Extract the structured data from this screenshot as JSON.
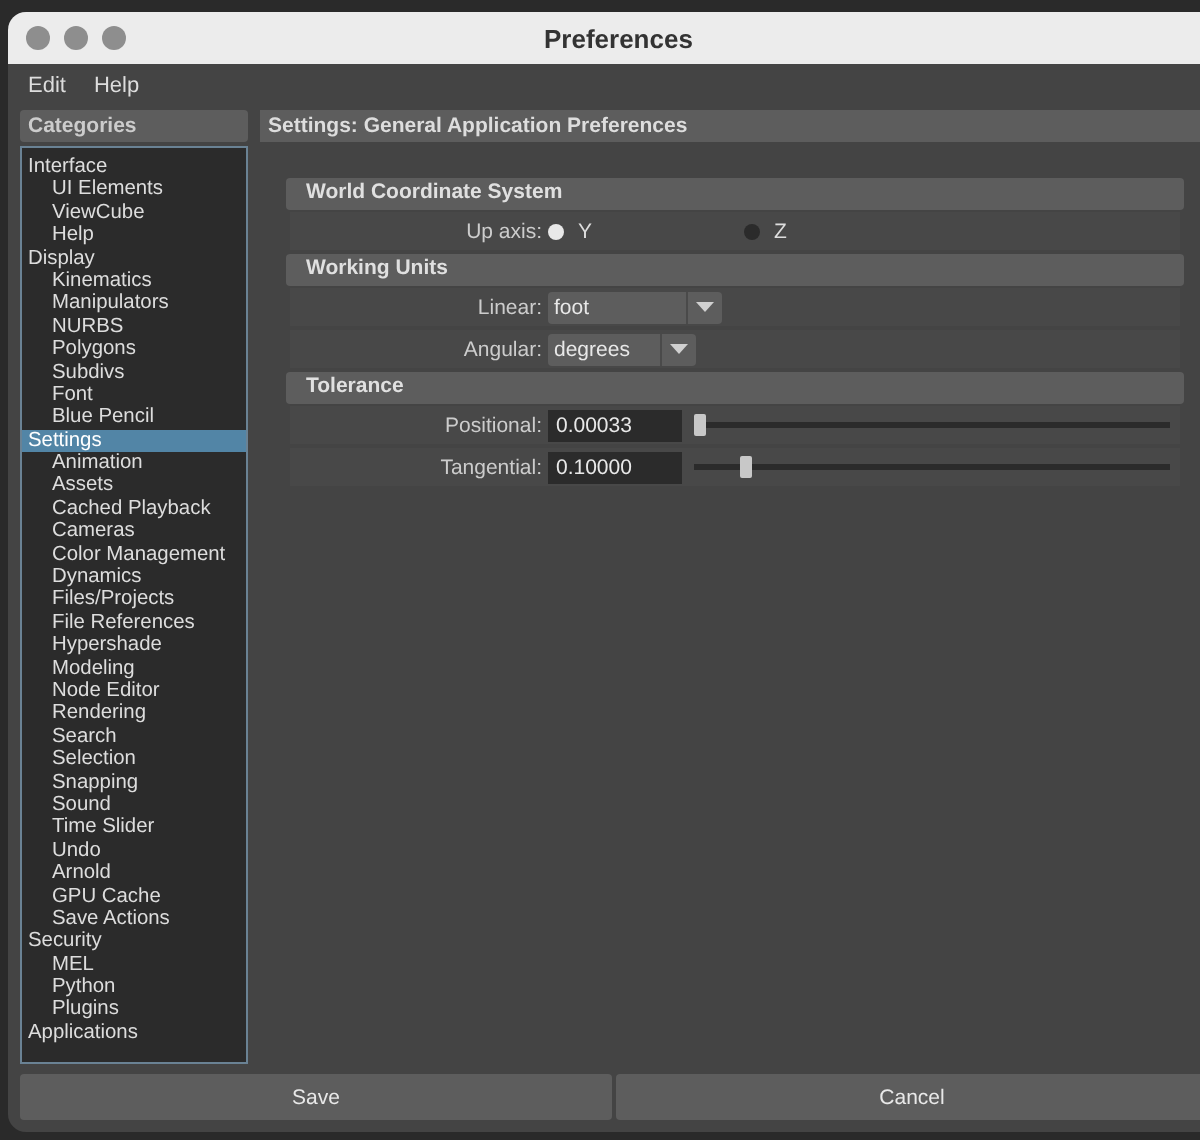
{
  "window": {
    "title": "Preferences"
  },
  "menu_bar": [
    "Edit",
    "Help"
  ],
  "categories": {
    "title": "Categories",
    "items": [
      {
        "label": "Interface",
        "selected": false,
        "children": [
          {
            "label": "UI Elements",
            "selected": false
          },
          {
            "label": "ViewCube",
            "selected": false
          },
          {
            "label": "Help",
            "selected": false
          }
        ]
      },
      {
        "label": "Display",
        "selected": false,
        "children": [
          {
            "label": "Kinematics",
            "selected": false
          },
          {
            "label": "Manipulators",
            "selected": false
          },
          {
            "label": "NURBS",
            "selected": false
          },
          {
            "label": "Polygons",
            "selected": false
          },
          {
            "label": "Subdivs",
            "selected": false
          },
          {
            "label": "Font",
            "selected": false
          },
          {
            "label": "Blue Pencil",
            "selected": false
          }
        ]
      },
      {
        "label": "Settings",
        "selected": true,
        "children": [
          {
            "label": "Animation",
            "selected": false
          },
          {
            "label": "Assets",
            "selected": false
          },
          {
            "label": "Cached Playback",
            "selected": false
          },
          {
            "label": "Cameras",
            "selected": false
          },
          {
            "label": "Color Management",
            "selected": false
          },
          {
            "label": "Dynamics",
            "selected": false
          },
          {
            "label": "Files/Projects",
            "selected": false
          },
          {
            "label": "File References",
            "selected": false
          },
          {
            "label": "Hypershade",
            "selected": false
          },
          {
            "label": "Modeling",
            "selected": false
          },
          {
            "label": "Node Editor",
            "selected": false
          },
          {
            "label": "Rendering",
            "selected": false
          },
          {
            "label": "Search",
            "selected": false
          },
          {
            "label": "Selection",
            "selected": false
          },
          {
            "label": "Snapping",
            "selected": false
          },
          {
            "label": "Sound",
            "selected": false
          },
          {
            "label": "Time Slider",
            "selected": false
          },
          {
            "label": "Undo",
            "selected": false
          },
          {
            "label": "Arnold",
            "selected": false
          },
          {
            "label": "GPU Cache",
            "selected": false
          },
          {
            "label": "Save Actions",
            "selected": false
          }
        ]
      },
      {
        "label": "Security",
        "selected": false,
        "children": [
          {
            "label": "MEL",
            "selected": false
          },
          {
            "label": "Python",
            "selected": false
          },
          {
            "label": "Plugins",
            "selected": false
          }
        ]
      },
      {
        "label": "Applications",
        "selected": false
      }
    ]
  },
  "panel": {
    "title": "Settings: General Application Preferences",
    "sections": [
      {
        "title": "World Coordinate System",
        "rows": [
          {
            "kind": "radio",
            "label": "Up axis:",
            "options": [
              {
                "label": "Y",
                "selected": true
              },
              {
                "label": "Z",
                "selected": false
              }
            ]
          }
        ]
      },
      {
        "title": "Working Units",
        "rows": [
          {
            "kind": "dropdown",
            "label": "Linear:",
            "value": "foot"
          },
          {
            "kind": "dropdown",
            "label": "Angular:",
            "value": "degrees"
          }
        ]
      },
      {
        "title": "Tolerance",
        "rows": [
          {
            "kind": "slider",
            "label": "Positional:",
            "value": "0.00033",
            "level": 0.0
          },
          {
            "kind": "slider",
            "label": "Tangential:",
            "value": "0.10000",
            "level": 0.1
          }
        ]
      }
    ]
  },
  "buttons": [
    "Save",
    "Cancel"
  ]
}
